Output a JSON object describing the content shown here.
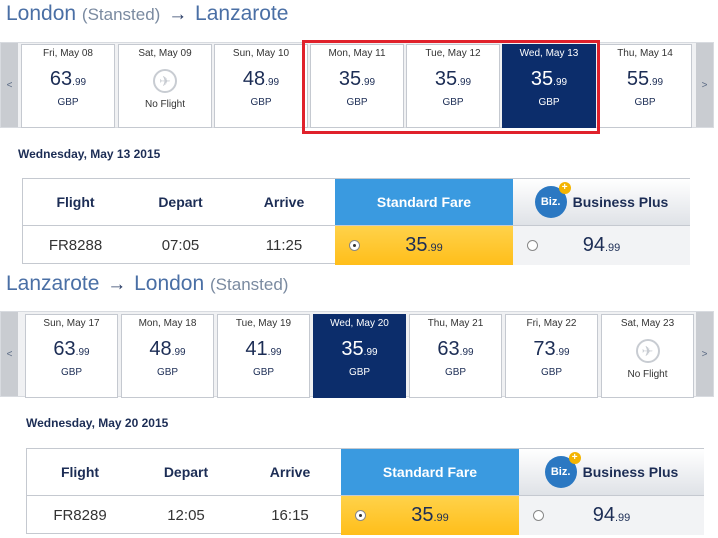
{
  "outbound": {
    "route": {
      "from": "London",
      "from_sub": "(Stansted)",
      "arrow": "→",
      "to": "Lanzarote"
    },
    "days": [
      {
        "date": "Fri, May 08",
        "price_main": "63",
        "price_dec": ".99",
        "currency": "GBP",
        "selected": false,
        "no_flight": false
      },
      {
        "date": "Sat, May 09",
        "no_flight": true,
        "no_flight_label": "No Flight"
      },
      {
        "date": "Sun, May 10",
        "price_main": "48",
        "price_dec": ".99",
        "currency": "GBP"
      },
      {
        "date": "Mon, May 11",
        "price_main": "35",
        "price_dec": ".99",
        "currency": "GBP"
      },
      {
        "date": "Tue, May 12",
        "price_main": "35",
        "price_dec": ".99",
        "currency": "GBP"
      },
      {
        "date": "Wed, May 13",
        "price_main": "35",
        "price_dec": ".99",
        "currency": "GBP",
        "selected": true
      },
      {
        "date": "Thu, May 14",
        "price_main": "55",
        "price_dec": ".99",
        "currency": "GBP"
      }
    ],
    "selected_date_heading": "Wednesday, May 13 2015",
    "table": {
      "headers": {
        "flight": "Flight",
        "depart": "Depart",
        "arrive": "Arrive",
        "standard": "Standard Fare",
        "business": "Business Plus",
        "biz_badge": "Biz."
      },
      "row": {
        "flight": "FR8288",
        "depart": "07:05",
        "arrive": "11:25",
        "standard_main": "35",
        "standard_dec": ".99",
        "business_main": "94",
        "business_dec": ".99"
      }
    }
  },
  "inbound": {
    "route": {
      "from": "Lanzarote",
      "arrow": "→",
      "to": "London",
      "to_sub": "(Stansted)"
    },
    "days": [
      {
        "date": "Sun, May 17",
        "price_main": "63",
        "price_dec": ".99",
        "currency": "GBP"
      },
      {
        "date": "Mon, May 18",
        "price_main": "48",
        "price_dec": ".99",
        "currency": "GBP"
      },
      {
        "date": "Tue, May 19",
        "price_main": "41",
        "price_dec": ".99",
        "currency": "GBP"
      },
      {
        "date": "Wed, May 20",
        "price_main": "35",
        "price_dec": ".99",
        "currency": "GBP",
        "selected": true
      },
      {
        "date": "Thu, May 21",
        "price_main": "63",
        "price_dec": ".99",
        "currency": "GBP"
      },
      {
        "date": "Fri, May 22",
        "price_main": "73",
        "price_dec": ".99",
        "currency": "GBP"
      },
      {
        "date": "Sat, May 23",
        "no_flight": true,
        "no_flight_label": "No Flight"
      }
    ],
    "selected_date_heading": "Wednesday, May 20 2015",
    "table": {
      "headers": {
        "flight": "Flight",
        "depart": "Depart",
        "arrive": "Arrive",
        "standard": "Standard Fare",
        "business": "Business Plus",
        "biz_badge": "Biz."
      },
      "row": {
        "flight": "FR8289",
        "depart": "12:05",
        "arrive": "16:15",
        "standard_main": "35",
        "standard_dec": ".99",
        "business_main": "94",
        "business_dec": ".99"
      }
    }
  },
  "nav": {
    "prev": "<",
    "next": ">"
  },
  "colors": {
    "selected_day": "#0c2d6b",
    "standard_header": "#3a9ae0",
    "standard_cell": "#ffc72c",
    "highlight": "#e0212b"
  }
}
